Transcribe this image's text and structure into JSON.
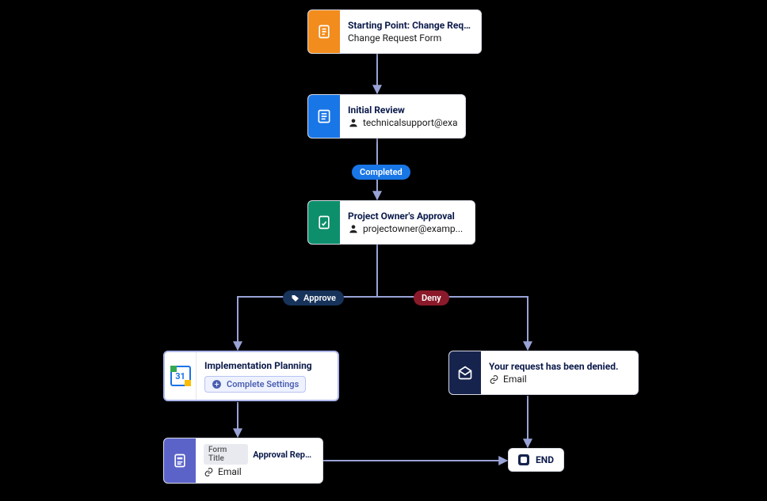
{
  "nodes": {
    "start": {
      "title": "Starting Point: Change Requ...",
      "subtitle": "Change Request Form"
    },
    "initial_review": {
      "title": "Initial Review",
      "assignee": "technicalsupport@exa..."
    },
    "owner_approval": {
      "title": "Project Owner's Approval",
      "assignee": "projectowner@examp..."
    },
    "impl_planning": {
      "title": "Implementation Planning",
      "settings_label": "Complete Settings",
      "calendar_day": "31"
    },
    "denied": {
      "title": "Your request has been denied.",
      "channel": "Email"
    },
    "approval_report": {
      "form_title_label": "Form Title",
      "form_title_value": "Approval Report",
      "channel": "Email"
    },
    "end": {
      "label": "END"
    }
  },
  "edges": {
    "completed": "Completed",
    "approve": "Approve",
    "deny": "Deny"
  }
}
